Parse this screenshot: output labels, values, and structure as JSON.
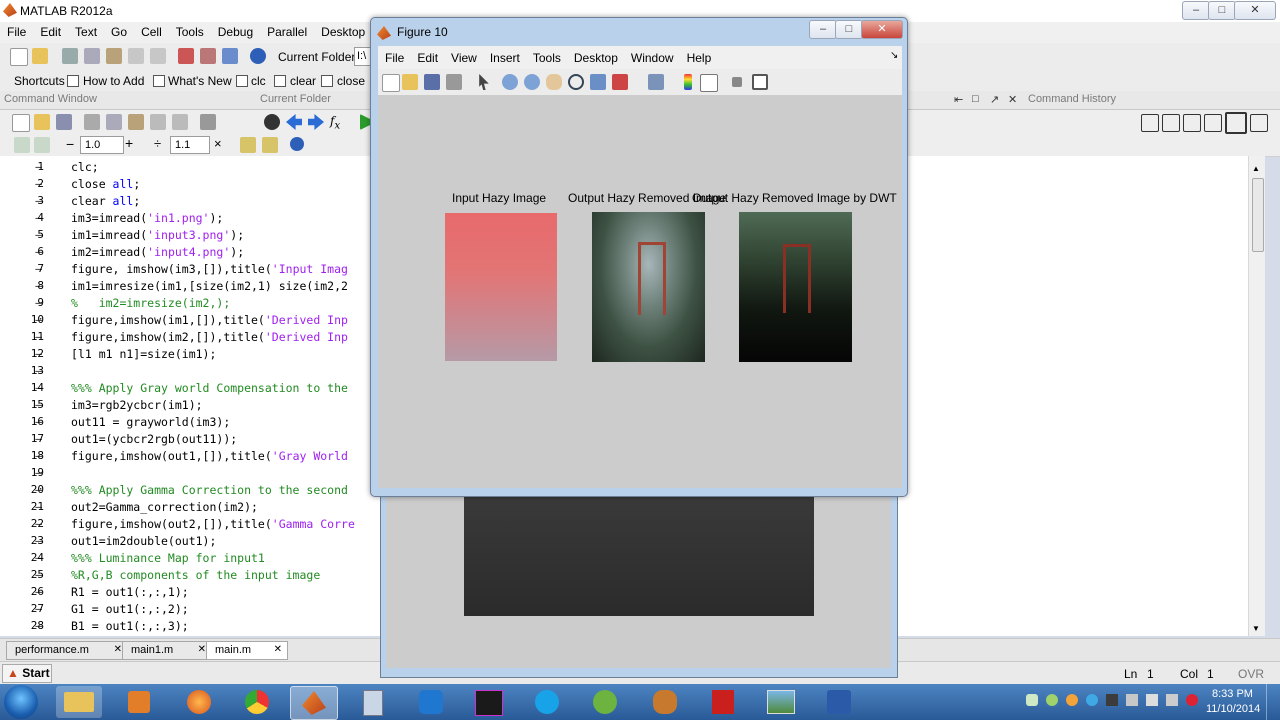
{
  "app": {
    "title": "MATLAB  R2012a"
  },
  "menu": [
    "File",
    "Edit",
    "Text",
    "Go",
    "Cell",
    "Tools",
    "Debug",
    "Parallel",
    "Desktop"
  ],
  "toolbar": {
    "current_folder_label": "Current Folder:",
    "current_folder_value": "I:\\"
  },
  "shortcuts": [
    {
      "label": "Shortcuts"
    },
    {
      "label": "How to Add"
    },
    {
      "label": "What's New"
    },
    {
      "label": "clc"
    },
    {
      "label": "clear"
    },
    {
      "label": "close"
    }
  ],
  "panels": {
    "command_window": "Command Window",
    "current_folder": "Current Folder",
    "command_history": "Command History"
  },
  "cell_toolbar": {
    "step1": "1.0",
    "step2": "1.1"
  },
  "code_lines": [
    {
      "n": "1",
      "t": [
        [
          "",
          "clc;"
        ]
      ]
    },
    {
      "n": "2",
      "t": [
        [
          "",
          "close "
        ],
        [
          "kw",
          "all"
        ],
        [
          "",
          ";"
        ]
      ]
    },
    {
      "n": "3",
      "t": [
        [
          "",
          "clear "
        ],
        [
          "kw",
          "all"
        ],
        [
          "",
          ";"
        ]
      ]
    },
    {
      "n": "4",
      "t": [
        [
          "",
          "im3=imread("
        ],
        [
          "str",
          "'in1.png'"
        ],
        [
          "",
          ");"
        ]
      ]
    },
    {
      "n": "5",
      "t": [
        [
          "",
          "im1=imread("
        ],
        [
          "str",
          "'input3.png'"
        ],
        [
          "",
          ");"
        ]
      ]
    },
    {
      "n": "6",
      "t": [
        [
          "",
          "im2=imread("
        ],
        [
          "str",
          "'input4.png'"
        ],
        [
          "",
          ");"
        ]
      ]
    },
    {
      "n": "7",
      "t": [
        [
          "",
          "figure, imshow(im3,[]),title("
        ],
        [
          "str",
          "'Input Imag"
        ]
      ]
    },
    {
      "n": "8",
      "t": [
        [
          "",
          "im1=imresize(im1,[size(im2,1) size(im2,2"
        ]
      ]
    },
    {
      "n": "9",
      "t": [
        [
          "cm",
          "%   im2=imresize(im2,);"
        ]
      ]
    },
    {
      "n": "10",
      "t": [
        [
          "",
          "figure,imshow(im1,[]),title("
        ],
        [
          "str",
          "'Derived Inp"
        ]
      ]
    },
    {
      "n": "11",
      "t": [
        [
          "",
          "figure,imshow(im2,[]),title("
        ],
        [
          "str",
          "'Derived Inp"
        ]
      ]
    },
    {
      "n": "12",
      "t": [
        [
          "",
          "[l1 m1 n1]=size(im1);"
        ]
      ]
    },
    {
      "n": "13",
      "t": []
    },
    {
      "n": "14",
      "t": [
        [
          "cm",
          "%%% Apply Gray world Compensation to the"
        ]
      ]
    },
    {
      "n": "15",
      "t": [
        [
          "",
          "im3=rgb2ycbcr(im1);"
        ]
      ]
    },
    {
      "n": "16",
      "t": [
        [
          "",
          "out11 = grayworld(im3);"
        ]
      ]
    },
    {
      "n": "17",
      "t": [
        [
          "",
          "out1=(ycbcr2rgb(out11));"
        ]
      ]
    },
    {
      "n": "18",
      "t": [
        [
          "",
          "figure,imshow(out1,[]),title("
        ],
        [
          "str",
          "'Gray World"
        ]
      ]
    },
    {
      "n": "19",
      "t": []
    },
    {
      "n": "20",
      "t": [
        [
          "cm",
          "%%% Apply Gamma Correction to the second"
        ]
      ]
    },
    {
      "n": "21",
      "t": [
        [
          "",
          "out2=Gamma_correction(im2);"
        ]
      ]
    },
    {
      "n": "22",
      "t": [
        [
          "",
          "figure,imshow(out2,[]),title("
        ],
        [
          "str",
          "'Gamma Corre"
        ]
      ]
    },
    {
      "n": "23",
      "t": [
        [
          "",
          "out1=im2double(out1);"
        ]
      ]
    },
    {
      "n": "24",
      "t": [
        [
          "cm",
          "%%% Luminance Map for input1"
        ]
      ]
    },
    {
      "n": "25",
      "t": [
        [
          "cm",
          "%R,G,B components of the input image"
        ]
      ]
    },
    {
      "n": "26",
      "t": [
        [
          "",
          "R1 = out1(:,:,1);"
        ]
      ]
    },
    {
      "n": "27",
      "t": [
        [
          "",
          "G1 = out1(:,:,2);"
        ]
      ]
    },
    {
      "n": "28",
      "t": [
        [
          "",
          "B1 = out1(:,:,3);"
        ]
      ]
    },
    {
      "n": "29",
      "t": []
    }
  ],
  "editor_tabs": [
    "performance.m",
    "main1.m",
    "main.m"
  ],
  "status": {
    "start": "Start",
    "ln_label": "Ln",
    "ln_value": "1",
    "col_label": "Col",
    "col_value": "1",
    "ovr": "OVR"
  },
  "figure": {
    "title": "Figure 10",
    "menu": [
      "File",
      "Edit",
      "View",
      "Insert",
      "Tools",
      "Desktop",
      "Window",
      "Help"
    ],
    "images": [
      {
        "title": "Input Hazy Image"
      },
      {
        "title": "Output Hazy Removed Image"
      },
      {
        "title": "Output Hazy Removed Image by DWT"
      }
    ]
  },
  "clock": {
    "time": "8:33 PM",
    "date": "11/10/2014"
  }
}
